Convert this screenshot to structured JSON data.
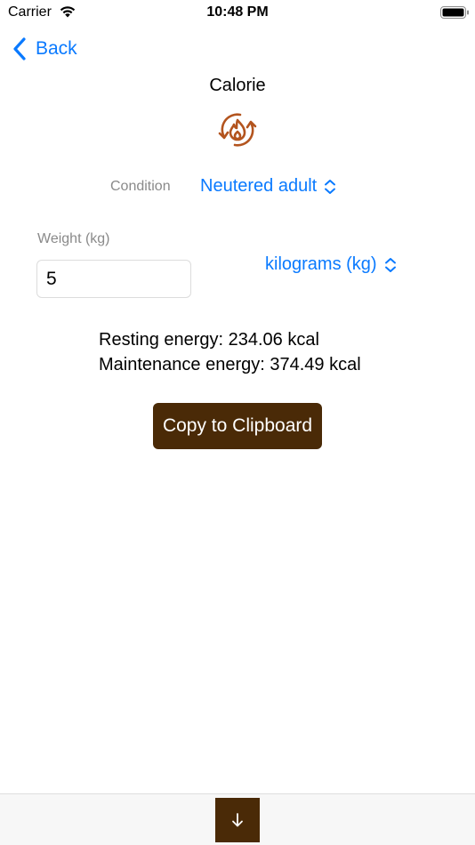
{
  "status_bar": {
    "carrier": "Carrier",
    "time": "10:48 PM"
  },
  "nav": {
    "back_label": "Back"
  },
  "page": {
    "title": "Calorie",
    "icon": "flame-cycle-icon"
  },
  "condition": {
    "label": "Condition",
    "selected": "Neutered adult"
  },
  "weight": {
    "label": "Weight (kg)",
    "value": "5",
    "unit_selected": "kilograms (kg)"
  },
  "results": {
    "resting": "Resting energy: 234.06 kcal",
    "maintenance": "Maintenance energy: 374.49 kcal"
  },
  "actions": {
    "copy_label": "Copy to Clipboard",
    "scroll_down_symbol": "↓"
  },
  "colors": {
    "accent": "#0a7aff",
    "brand_brown": "#4a2a07",
    "icon_orange": "#b3541e"
  }
}
